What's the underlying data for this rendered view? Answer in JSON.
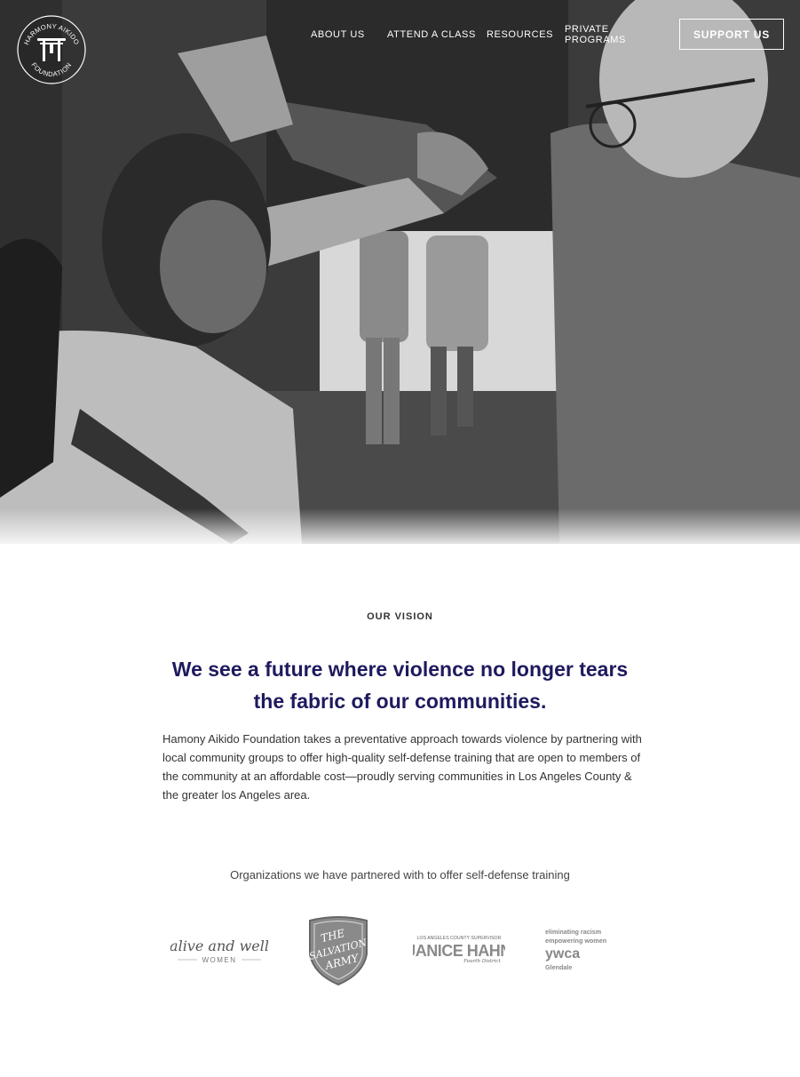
{
  "header": {
    "logo_text_top": "HARMONY AIKIDO",
    "logo_text_bottom": "FOUNDATION",
    "nav": {
      "about": "ABOUT US",
      "attend": "ATTEND A CLASS",
      "resources": "RESOURCES",
      "private_line1": "PRIVATE",
      "private_line2": "PROGRAMS"
    },
    "support_button": "SUPPORT US"
  },
  "vision": {
    "eyebrow": "OUR VISION",
    "headline": "We see a future where violence no longer tears the fabric of our communities.",
    "body": "Hamony Aikido Foundation takes a preventative approach towards violence by partnering with local community groups to offer high-quality self-defense training that are open to members of the community at an affordable cost—proudly serving communities in Los Angeles County & the greater los Angeles area."
  },
  "partners": {
    "title": "Organizations we have partnered with to offer self-defense training",
    "alive": {
      "line1": "alive and well",
      "line2": "WOMEN"
    },
    "salvation": {
      "line1": "THE",
      "line2": "SALVATION",
      "line3": "ARMY"
    },
    "hahn": {
      "line1": "LOS ANGELES COUNTY SUPERVISOR",
      "line2": "JANICE HAHN",
      "line3": "Fourth District"
    },
    "ywca": {
      "line1": "eliminating racism",
      "line2": "empowering women",
      "line3": "ywca",
      "line4": "Glendale"
    }
  },
  "colors": {
    "headline": "#1e1a5e",
    "nav_text": "#ffffff"
  }
}
